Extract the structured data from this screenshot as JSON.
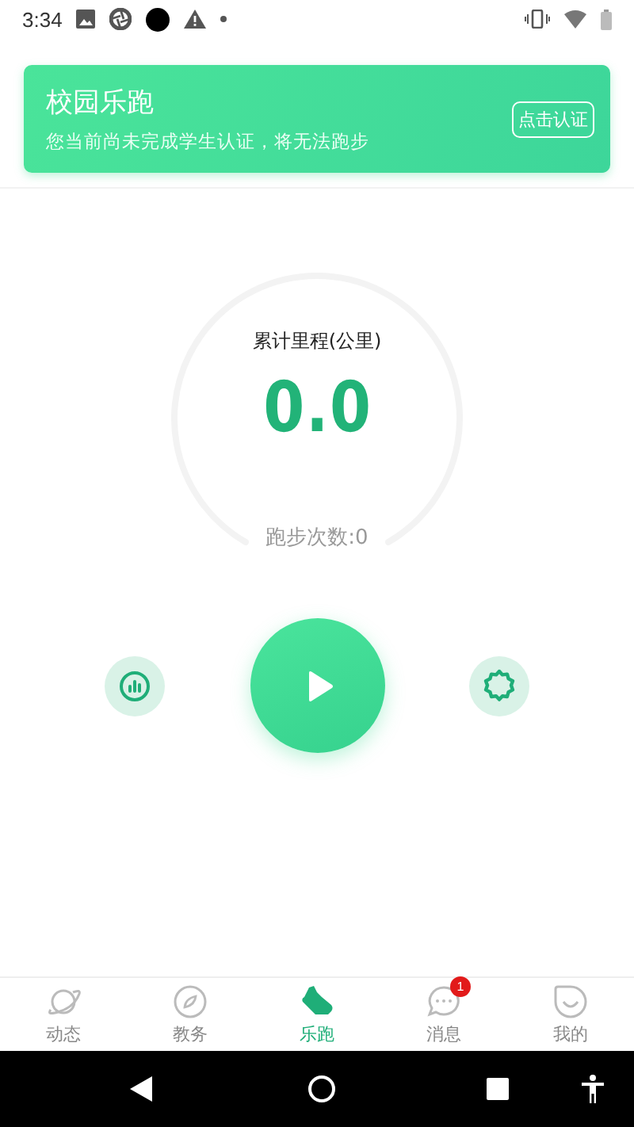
{
  "status_bar": {
    "time": "3:34"
  },
  "banner": {
    "title": "校园乐跑",
    "message": "您当前尚未完成学生认证，将无法跑步",
    "button": "点击认证"
  },
  "stats": {
    "distance_label": "累计里程(公里)",
    "distance": "0.0",
    "runs": "跑步次数:0"
  },
  "tabs": [
    {
      "kind": "planet",
      "label": "动态",
      "selected": false
    },
    {
      "kind": "compass",
      "label": "教务",
      "selected": false
    },
    {
      "kind": "shoe",
      "label": "乐跑",
      "selected": true
    },
    {
      "kind": "chat",
      "label": "消息",
      "selected": false,
      "badge": "1"
    },
    {
      "kind": "smile",
      "label": "我的",
      "selected": false
    }
  ]
}
